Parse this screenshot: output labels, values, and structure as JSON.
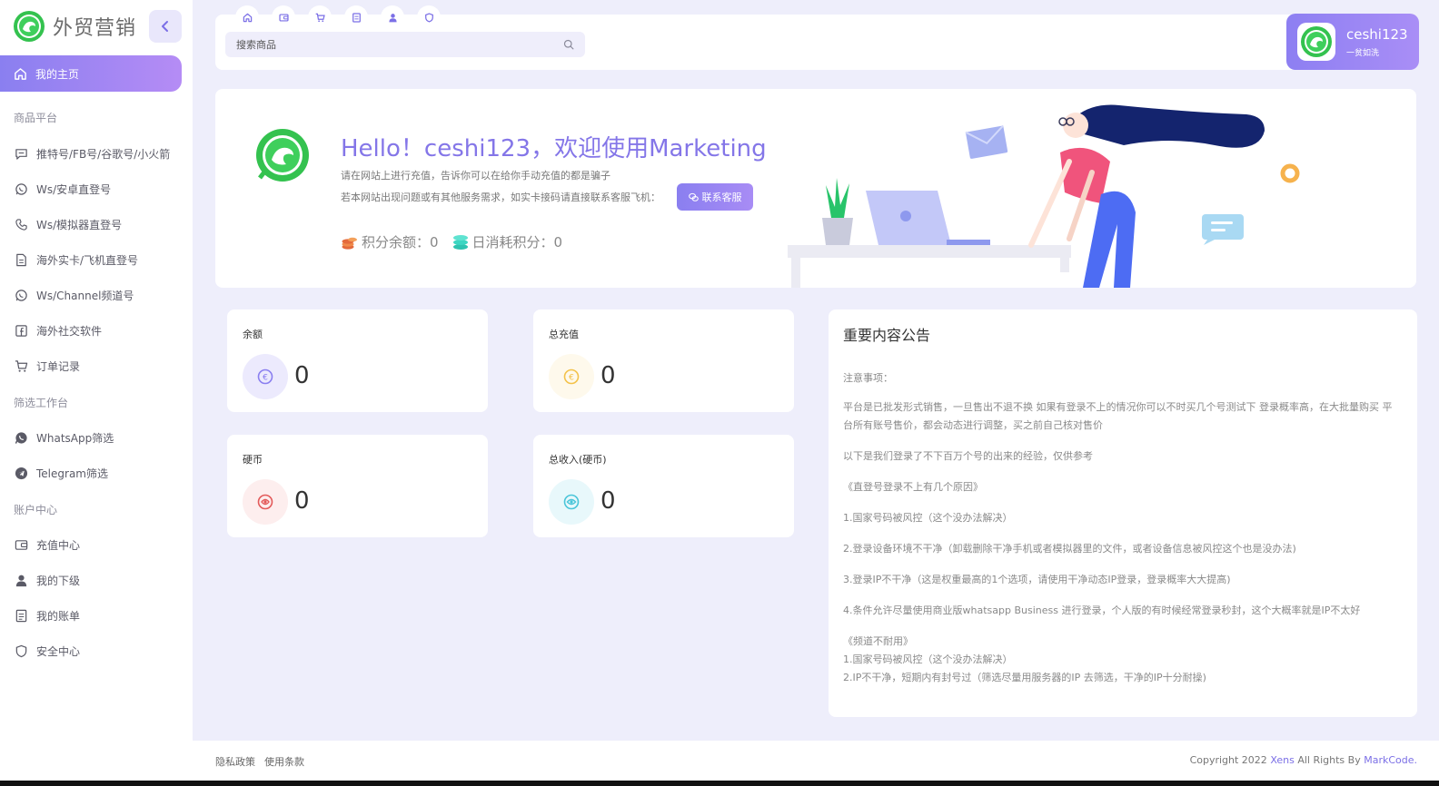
{
  "colors": {
    "accent": "#8a7ff0",
    "accent_gradient_end": "#b58cf5",
    "page_bg": "#eeeefb",
    "logo_green": "#33c24d"
  },
  "sidebar": {
    "brand": "外贸营销",
    "home": "我的主页",
    "sections": {
      "products": "商品平台",
      "filter": "筛选工作台",
      "account": "账户中心"
    },
    "product_items": [
      {
        "label": "推特号/FB号/谷歌号/小火箭",
        "icon": "chat-bubble-icon"
      },
      {
        "label": "Ws/安卓直登号",
        "icon": "whatsapp-icon"
      },
      {
        "label": "Ws/模拟器直登号",
        "icon": "phone-icon"
      },
      {
        "label": "海外实卡/飞机直登号",
        "icon": "document-icon"
      },
      {
        "label": "Ws/Channel频道号",
        "icon": "whatsapp-icon"
      },
      {
        "label": "海外社交软件",
        "icon": "facebook-icon"
      },
      {
        "label": "订单记录",
        "icon": "cart-icon"
      }
    ],
    "filter_items": [
      {
        "label": "WhatsApp筛选",
        "icon": "whatsapp-icon"
      },
      {
        "label": "Telegram筛选",
        "icon": "telegram-icon"
      }
    ],
    "account_items": [
      {
        "label": "充值中心",
        "icon": "wallet-icon"
      },
      {
        "label": "我的下级",
        "icon": "user-icon"
      },
      {
        "label": "我的账单",
        "icon": "bill-icon"
      },
      {
        "label": "安全中心",
        "icon": "shield-icon"
      }
    ]
  },
  "topbar": {
    "quick_icons": [
      "home-icon",
      "wallet-icon",
      "cart-icon",
      "bill-icon",
      "user-icon",
      "shield-icon"
    ],
    "search_placeholder": "搜索商品"
  },
  "user": {
    "name": "ceshi123",
    "tag": "一贫如洗"
  },
  "hero": {
    "title": "Hello！ceshi123，欢迎使用Marketing",
    "line1": "请在网站上进行充值，告诉你可以在给你手动充值的都是骗子",
    "line2": "若本网站出现问题或有其他服务需求，如实卡接码请直接联系客服飞机：",
    "contact_button": "联系客服",
    "points_label": "积分余额：0",
    "daily_label": "日消耗积分：0"
  },
  "stats": [
    {
      "label": "余额",
      "value": "0",
      "icon": "euro-icon",
      "color": "#8a7ff0",
      "bg": "#eceafd"
    },
    {
      "label": "总充值",
      "value": "0",
      "icon": "euro-coin-icon",
      "color": "#f3c24a",
      "bg": "#fef9ec"
    },
    {
      "label": "硬币",
      "value": "0",
      "icon": "target-icon",
      "color": "#e35a5a",
      "bg": "#fdeeee"
    },
    {
      "label": "总收入(硬币)",
      "value": "0",
      "icon": "eye-icon",
      "color": "#4ac5d9",
      "bg": "#e8f8fb"
    }
  ],
  "notice": {
    "title": "重要内容公告",
    "lines": [
      "注意事项：",
      "",
      "平台是已批发形式销售，一旦售出不退不换 如果有登录不上的情况你可以不时买几个号测试下 登录概率高，在大批量购买 平台所有账号售价，都会动态进行调整，买之前自己核对售价",
      "",
      "以下是我们登录了不下百万个号的出来的经验，仅供参考",
      "",
      "《直登号登录不上有几个原因》",
      "",
      "1.国家号码被风控（这个没办法解决）",
      "",
      "2.登录设备环境不干净（卸载删除干净手机或者模拟器里的文件，或者设备信息被风控这个也是没办法)",
      "",
      "3.登录IP不干净（这是权重最高的1个选项，请使用干净动态IP登录，登录概率大大提高)",
      "",
      "4.条件允许尽量使用商业版whatsapp Business 进行登录，个人版的有时候经常登录秒封，这个大概率就是IP不太好",
      "",
      "《频道不耐用》",
      "1.国家号码被风控（这个没办法解决）",
      "2.IP不干净，短期内有封号过（筛选尽量用服务器的IP 去筛选，干净的IP十分耐操)"
    ]
  },
  "footer": {
    "privacy": "隐私政策",
    "terms": "使用条款",
    "copy_prefix": "Copyright 2022",
    "copy_brand": "Xens",
    "copy_mid": "All Rights By",
    "copy_by": "MarkCode."
  }
}
